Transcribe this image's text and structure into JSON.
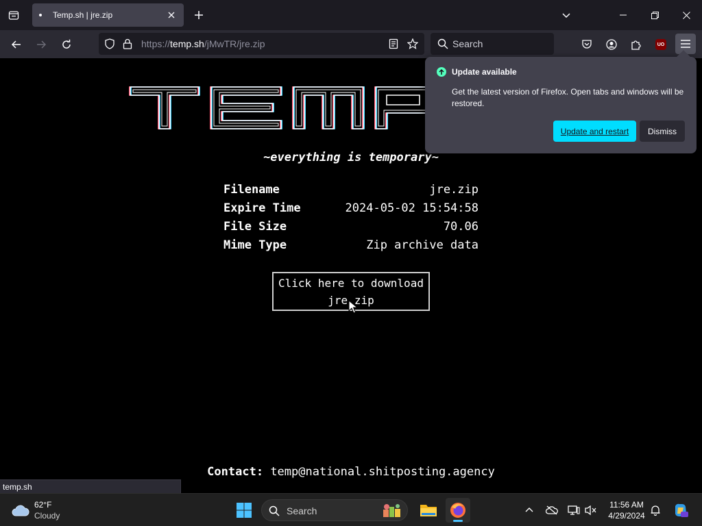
{
  "browser": {
    "tab": {
      "title": "Temp.sh | jre.zip"
    },
    "url": {
      "prefix": "https://",
      "host": "temp.sh",
      "path": "/jMwTR/jre.zip"
    },
    "search": {
      "placeholder": "Search"
    },
    "ublock_label": "UO"
  },
  "page": {
    "logo_text": "TEMP",
    "tagline": "~everything is temporary~",
    "file_info": [
      {
        "label": "Filename",
        "value": "jre.zip"
      },
      {
        "label": "Expire Time",
        "value": "2024-05-02 15:54:58"
      },
      {
        "label": "File Size",
        "value": "70.06"
      },
      {
        "label": "Mime Type",
        "value": "Zip archive data"
      }
    ],
    "download": {
      "line1": "Click here to download",
      "line2": "jre.zip"
    },
    "contact": {
      "label": "Contact:",
      "email": "temp@national.shitposting.agency"
    },
    "status_link": "temp.sh"
  },
  "update_popup": {
    "heading": "Update available",
    "description": "Get the latest version of Firefox. Open tabs and windows will be restored.",
    "primary_button": "Update and restart",
    "secondary_button": "Dismiss"
  },
  "taskbar": {
    "weather": {
      "temp": "62°F",
      "condition": "Cloudy"
    },
    "search_label": "Search",
    "clock": {
      "time": "11:56 AM",
      "date": "4/29/2024"
    }
  },
  "colors": {
    "accent": "#00ddff",
    "update_green": "#54ffbd",
    "tab_active": "#42414d",
    "toolbar": "#2b2a33",
    "tabstrip": "#1c1b22"
  }
}
